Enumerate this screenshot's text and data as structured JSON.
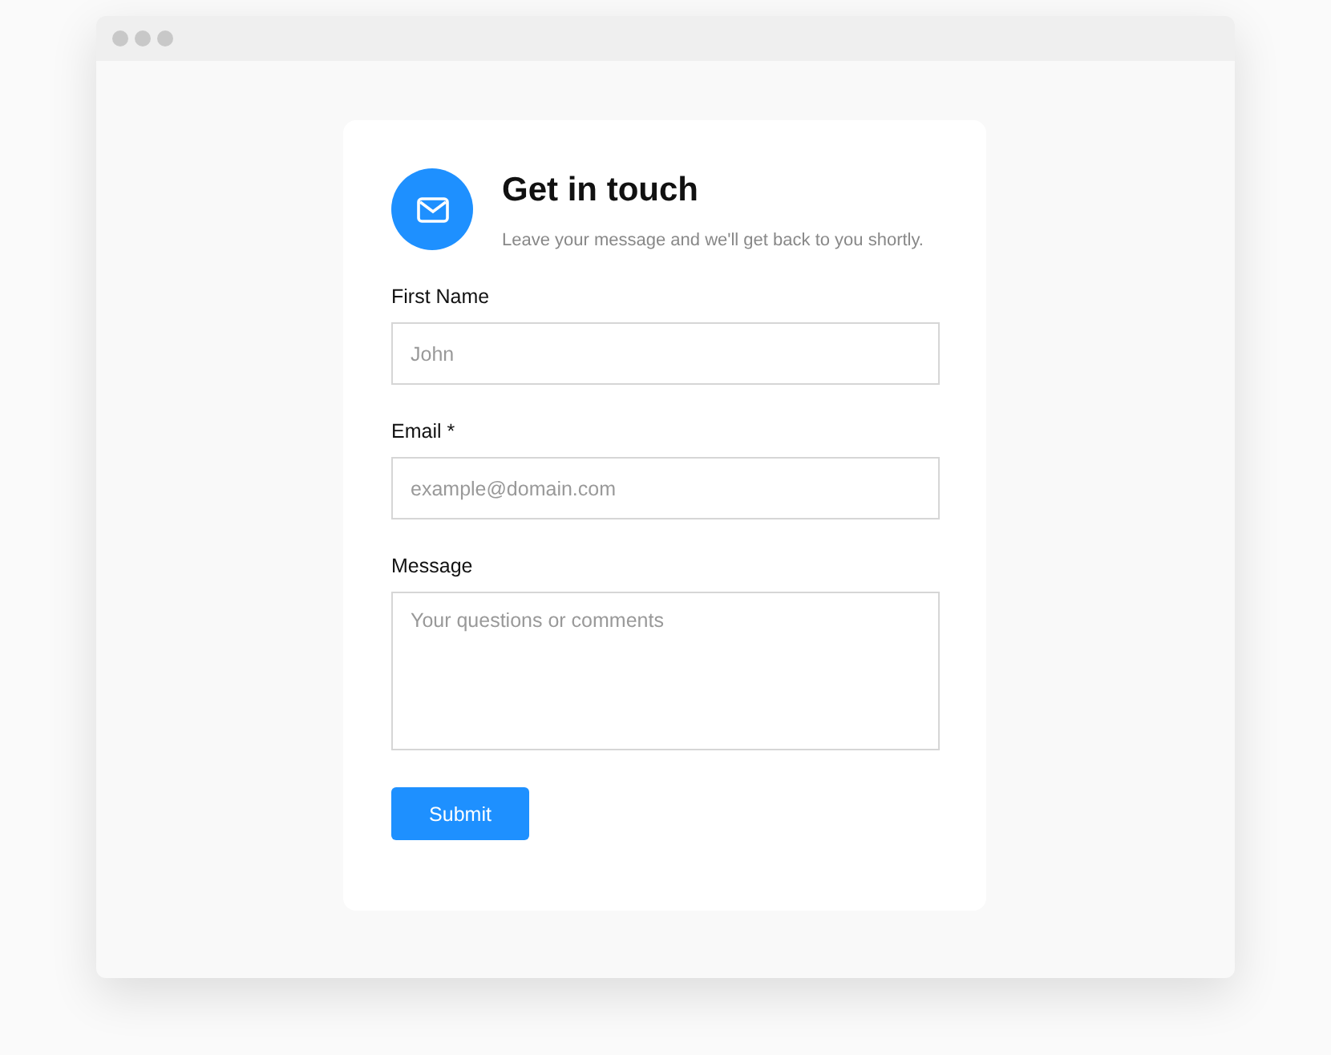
{
  "header": {
    "title": "Get in touch",
    "subtitle": "Leave your message and we'll get back to you shortly."
  },
  "fields": [
    {
      "kind": "input",
      "label": "First Name",
      "placeholder": "John"
    },
    {
      "kind": "input",
      "label": "Email *",
      "placeholder": "example@domain.com"
    },
    {
      "kind": "textarea",
      "label": "Message",
      "placeholder": "Your questions or comments"
    }
  ],
  "submit": "Submit"
}
